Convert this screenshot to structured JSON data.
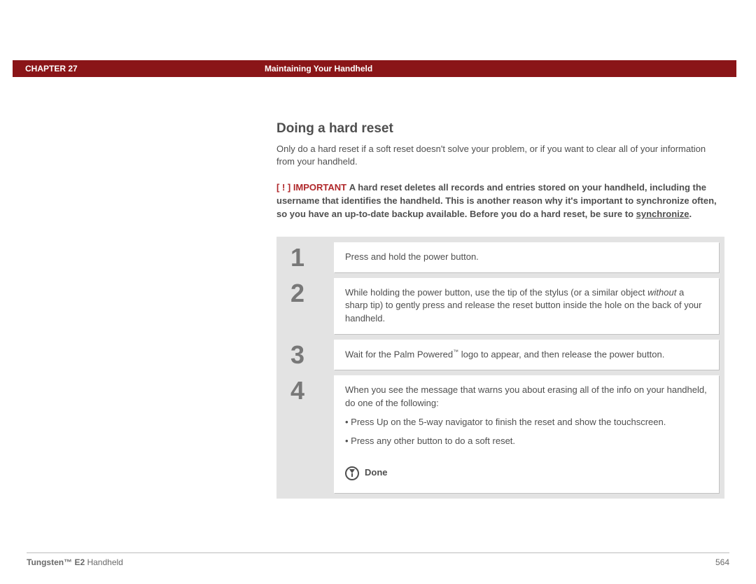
{
  "header": {
    "chapter": "CHAPTER 27",
    "title": "Maintaining Your Handheld"
  },
  "section": {
    "heading": "Doing a hard reset",
    "intro": "Only do a hard reset if a soft reset doesn't solve your problem, or if you want to clear all of your information from your handheld.",
    "important_label": "[ ! ] IMPORTANT",
    "important_text_1": "A hard reset deletes all records and entries stored on your handheld, including the username that identifies the handheld. This is another reason why it's important to synchronize often, so you have an up-to-date backup available. Before you do a hard reset, be sure to ",
    "important_link": "synchronize",
    "important_text_2": "."
  },
  "steps": [
    {
      "num": "1",
      "body": "Press and hold the power button."
    },
    {
      "num": "2",
      "pre": "While holding the power button, use the tip of the stylus (or a similar object ",
      "ital": "without",
      "post": " a sharp tip) to gently press and release the reset button inside the hole on the back of your handheld."
    },
    {
      "num": "3",
      "pre": "Wait for the Palm Powered",
      "tm": "™",
      "post": " logo to appear, and then release the power button."
    },
    {
      "num": "4",
      "lead": "When you see the message that warns you about erasing all of the info on your handheld, do one of the following:",
      "b1": "• Press Up on the 5-way navigator to finish the reset and show the touchscreen.",
      "b2": "• Press any other button to do a soft reset."
    }
  ],
  "done": "Done",
  "footer": {
    "product_bold": "Tungsten™ E2",
    "product_rest": " Handheld",
    "page": "564"
  }
}
